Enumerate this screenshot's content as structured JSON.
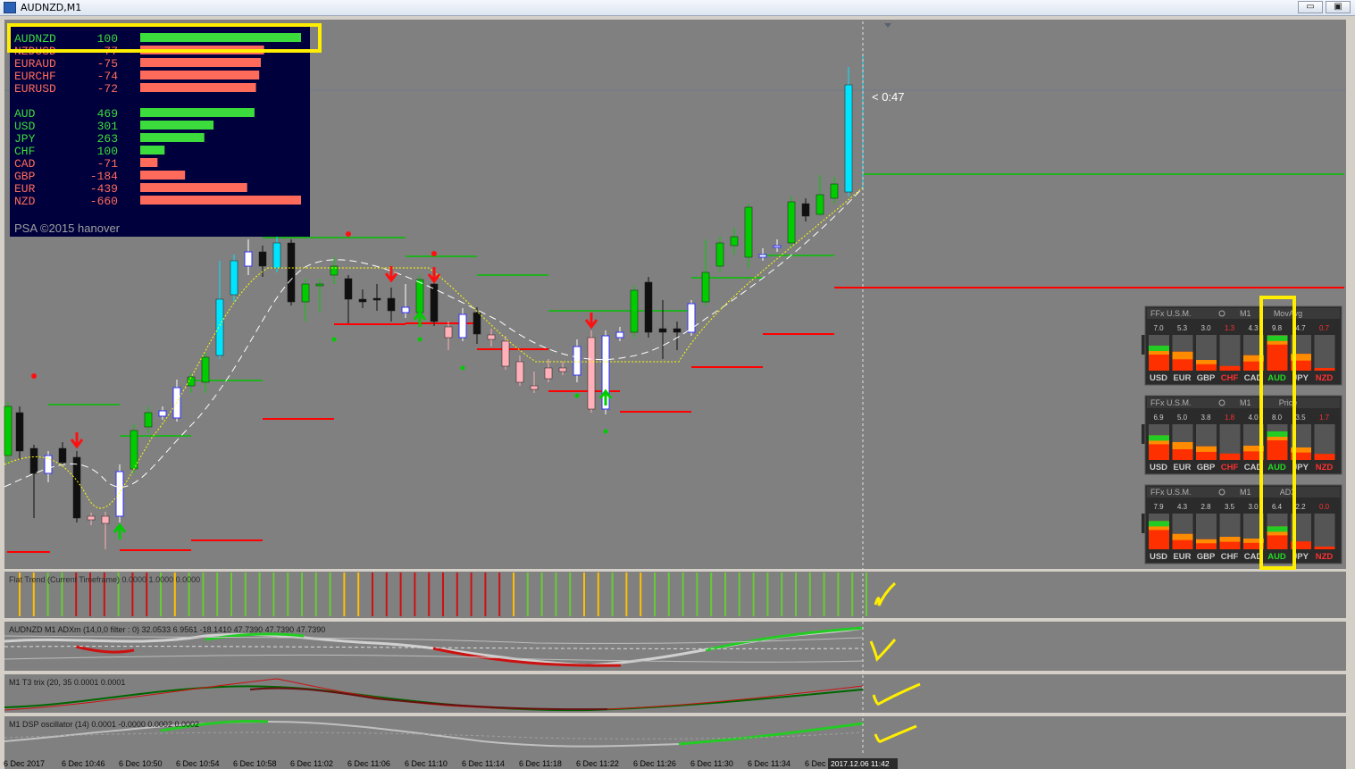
{
  "window": {
    "title": "AUDNZD,M1",
    "minimize_glyph": "▭",
    "restore_glyph": "▣"
  },
  "price": {
    "countdown": "< 0:47"
  },
  "psa_panel": {
    "pairs": [
      {
        "name": "AUDNZD",
        "value": "100",
        "strength": 100,
        "positive": true
      },
      {
        "name": "NZDUSD",
        "value": "-77",
        "strength": -77,
        "positive": false
      },
      {
        "name": "EURAUD",
        "value": "-75",
        "strength": -75,
        "positive": false
      },
      {
        "name": "EURCHF",
        "value": "-74",
        "strength": -74,
        "positive": false
      },
      {
        "name": "EURUSD",
        "value": "-72",
        "strength": -72,
        "positive": false
      }
    ],
    "currencies": [
      {
        "name": "AUD",
        "value": "469",
        "strength": 469,
        "positive": true
      },
      {
        "name": "USD",
        "value": "301",
        "strength": 301,
        "positive": true
      },
      {
        "name": "JPY",
        "value": "263",
        "strength": 263,
        "positive": true
      },
      {
        "name": "CHF",
        "value": "100",
        "strength": 100,
        "positive": true
      },
      {
        "name": "CAD",
        "value": "-71",
        "strength": -71,
        "positive": false
      },
      {
        "name": "GBP",
        "value": "-184",
        "strength": -184,
        "positive": false
      },
      {
        "name": "EUR",
        "value": "-439",
        "strength": -439,
        "positive": false
      },
      {
        "name": "NZD",
        "value": "-660",
        "strength": -660,
        "positive": false
      }
    ],
    "footer": "PSA ©2015 hanover"
  },
  "ffx_panels": [
    {
      "brand": "FFx U.S.M.",
      "timeframe": "M1",
      "indicator": "MovAvg",
      "currencies": [
        "USD",
        "EUR",
        "GBP",
        "CHF",
        "CAD",
        "AUD",
        "JPY",
        "NZD"
      ],
      "values": [
        "7.0",
        "5.3",
        "3.0",
        "1.3",
        "4.3",
        "9.8",
        "4.7",
        "0.7"
      ],
      "red_flags": [
        false,
        false,
        false,
        true,
        false,
        false,
        false,
        true
      ],
      "levels": [
        0.7,
        0.53,
        0.3,
        0.13,
        0.43,
        0.98,
        0.47,
        0.07
      ]
    },
    {
      "brand": "FFx U.S.M.",
      "timeframe": "M1",
      "indicator": "Price",
      "currencies": [
        "USD",
        "EUR",
        "GBP",
        "CHF",
        "CAD",
        "AUD",
        "JPY",
        "NZD"
      ],
      "values": [
        "6.9",
        "5.0",
        "3.8",
        "1.8",
        "4.0",
        "8.0",
        "3.5",
        "1.7"
      ],
      "red_flags": [
        false,
        false,
        false,
        true,
        false,
        false,
        false,
        true
      ],
      "levels": [
        0.69,
        0.5,
        0.38,
        0.18,
        0.4,
        0.8,
        0.35,
        0.17
      ]
    },
    {
      "brand": "FFx U.S.M.",
      "timeframe": "M1",
      "indicator": "ADX",
      "currencies": [
        "USD",
        "EUR",
        "GBP",
        "CHF",
        "CAD",
        "AUD",
        "JPY",
        "NZD"
      ],
      "values": [
        "7.9",
        "4.3",
        "2.8",
        "3.5",
        "3.0",
        "6.4",
        "2.2",
        "0.0"
      ],
      "red_flags": [
        false,
        false,
        false,
        false,
        false,
        false,
        false,
        true
      ],
      "levels": [
        0.79,
        0.43,
        0.28,
        0.35,
        0.3,
        0.64,
        0.22,
        0.0
      ]
    }
  ],
  "subwindows": {
    "flat_trend": "Flat Trend (Current Timeframe) 0.0000 1.0000 0.0000",
    "adx": "AUDNZD M1 ADXm (14,0,0 filter : 0) 32.0533 6.9561 -18.1410 47.7390 47.7390 47.7390",
    "t3trix": "M1 T3 trix (20, 35 0.0001 0.0001",
    "dsp": "M1 DSP oscillator (14) 0.0001 -0.0000 0.0002 0.0002"
  },
  "time_axis": {
    "labels": [
      "6 Dec 2017",
      "6 Dec 10:46",
      "6 Dec 10:50",
      "6 Dec 10:54",
      "6 Dec 10:58",
      "6 Dec 11:02",
      "6 Dec 11:06",
      "6 Dec 11:10",
      "6 Dec 11:14",
      "6 Dec 11:18",
      "6 Dec 11:22",
      "6 Dec 11:26",
      "6 Dec 11:30",
      "6 Dec 11:34",
      "6 Dec 11:38",
      "6 Dec 11:42"
    ],
    "current_marker": "2017.12.06 11:42"
  },
  "colors": {
    "chart_bg": "#808080",
    "bull_green": "#00cc00",
    "bull_cyan": "#00e5ff",
    "bear_black": "#101010",
    "bear_pink": "#ffb0b8",
    "resistance_red": "#ff0000",
    "support_green": "#00c000",
    "highlight_yellow": "#ffee00",
    "psa_bg": "#00003c"
  }
}
